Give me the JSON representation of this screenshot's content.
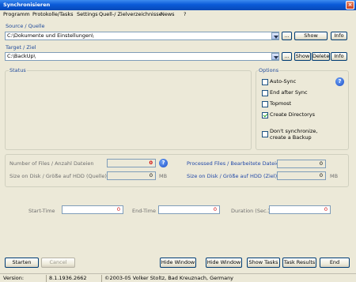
{
  "window": {
    "title": "Synchronisieren",
    "close": "×"
  },
  "menu": [
    "Programm",
    "Protokolle/Tasks",
    "Settings",
    "Quell-/ Zielverzeichnisse",
    "News",
    "?"
  ],
  "source": {
    "label": "Source / Quelle",
    "path": "C:\\Dokumente und Einstellungen\\",
    "browse": "...",
    "show": "Show",
    "info": "Info"
  },
  "target": {
    "label": "Target / Ziel",
    "path": "C:\\BackUp\\",
    "browse": "...",
    "show": "Show",
    "delete": "Delete",
    "info": "Info"
  },
  "status_label": "Status",
  "options": {
    "label": "Options",
    "items": [
      {
        "label": "Auto-Sync",
        "checked": false
      },
      {
        "label": "End after Sync",
        "checked": false
      },
      {
        "label": "Topmost",
        "checked": false
      },
      {
        "label": "Create Directorys",
        "checked": true
      }
    ],
    "dont_sync_line1": "Don't synchronize,",
    "dont_sync_line2": "create a Backup",
    "help": "?"
  },
  "stats": {
    "num_files_label": "Number of Files / Anzahl Dateien",
    "num_files_value": "0",
    "size_label": "Size on Disk / Größe auf HDD (Quelle)",
    "size_value": "0",
    "size_unit": "MB",
    "processed_label": "Processed Files / Bearbeitete Dateien",
    "processed_value": "0",
    "size_target_label": "Size on Disk / Größe auf HDD (Ziel)",
    "size_target_value": "0",
    "size_target_unit": "MB",
    "help": "?"
  },
  "times": {
    "start_label": "Start-Time",
    "start_value": "0",
    "end_label": "End-Time",
    "end_value": "0",
    "duration_label": "Duration (Sec.)",
    "duration_value": "0"
  },
  "buttons": {
    "start": "Starten",
    "cancel": "Cancel",
    "hide1": "Hide Window",
    "hide2": "Hide Window",
    "tasks": "Show Tasks",
    "results": "Task Results",
    "end": "End"
  },
  "statusbar": {
    "version_label": "Version:",
    "version_value": "8.1.1936.2662",
    "copyright": "©2003-05 Volker Stoltz, Bad Kreuznach, Germany"
  }
}
